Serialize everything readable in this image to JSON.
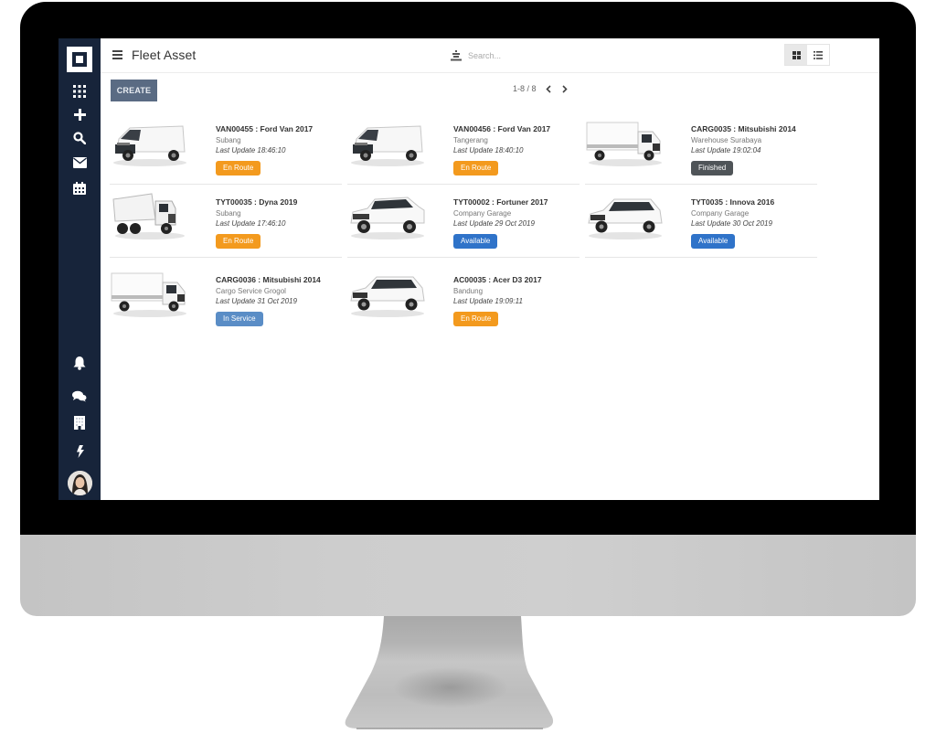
{
  "app": {
    "title": "Fleet Asset",
    "search": {
      "placeholder": "Search..."
    },
    "create_label": "CREATE",
    "pager": {
      "range": "1-8 / 8"
    },
    "view_modes": [
      {
        "name": "grid-view",
        "active": true
      },
      {
        "name": "list-view",
        "active": false
      }
    ]
  },
  "sidebar": {
    "top_icons": [
      "apps-grid-icon",
      "plus-icon",
      "search-icon",
      "mail-icon",
      "calendar-icon"
    ],
    "bottom_icons": [
      "bell-icon",
      "chat-icon",
      "building-icon",
      "bolt-icon"
    ],
    "avatar": "user-avatar"
  },
  "status_colors": {
    "En Route": "#f39a1e",
    "Finished": "#4f5458",
    "Available": "#2f73c9",
    "In Service": "#5a8dc6"
  },
  "assets": [
    {
      "title": "VAN00455 : Ford Van 2017",
      "location": "Subang",
      "updated": "Last Update 18:46:10",
      "status": "En Route",
      "vehicle": "van"
    },
    {
      "title": "VAN00456 : Ford Van 2017",
      "location": "Tangerang",
      "updated": "Last Update 18:40:10",
      "status": "En Route",
      "vehicle": "van"
    },
    {
      "title": "CARG0035 : Mitsubishi 2014",
      "location": "Warehouse Surabaya",
      "updated": "Last Update 19:02:04",
      "status": "Finished",
      "vehicle": "box-truck"
    },
    {
      "title": "TYT00035 : Dyna 2019",
      "location": "Subang",
      "updated": "Last Update 17:46:10",
      "status": "En Route",
      "vehicle": "dump-truck"
    },
    {
      "title": "TYT00002 : Fortuner 2017",
      "location": "Company Garage",
      "updated": "Last Update 29 Oct 2019",
      "status": "Available",
      "vehicle": "suv"
    },
    {
      "title": "TYT0035 : Innova 2016",
      "location": "Company Garage",
      "updated": "Last Update 30 Oct 2019",
      "status": "Available",
      "vehicle": "mpv"
    },
    {
      "title": "CARG0036 : Mitsubishi 2014",
      "location": "Cargo Service Grogol",
      "updated": "Last Update 31 Oct 2019",
      "status": "In Service",
      "vehicle": "box-truck"
    },
    {
      "title": "AC00035 : Acer D3 2017",
      "location": "Bandung",
      "updated": "Last Update 19:09:11",
      "status": "En Route",
      "vehicle": "mpv"
    }
  ]
}
